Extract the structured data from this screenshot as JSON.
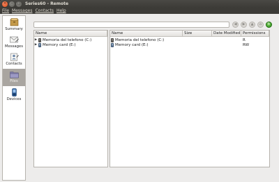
{
  "window": {
    "title": "Series60 - Remote"
  },
  "menubar": {
    "items": [
      {
        "label": "File"
      },
      {
        "label": "Messages"
      },
      {
        "label": "Contacts"
      },
      {
        "label": "Help"
      }
    ]
  },
  "sidebar": {
    "items": [
      {
        "label": "Summary",
        "icon": "summary-icon"
      },
      {
        "label": "Messages",
        "icon": "messages-icon"
      },
      {
        "label": "Contacts",
        "icon": "contacts-icon"
      },
      {
        "label": "Files",
        "icon": "folder-icon",
        "selected": true
      },
      {
        "label": "Devices",
        "icon": "phone-icon"
      }
    ]
  },
  "toolbar": {
    "path_value": "",
    "buttons": [
      "back-icon",
      "forward-icon",
      "up-icon",
      "home-icon",
      "refresh-icon"
    ]
  },
  "tree": {
    "header": "Name",
    "items": [
      {
        "label": "Memoria del telefono (C:)",
        "icon": "phone-icon"
      },
      {
        "label": "Memory card (E:)",
        "icon": "memory-card-icon"
      }
    ]
  },
  "list": {
    "columns": [
      "Name",
      "Size",
      "Date Modified",
      "Permissions"
    ],
    "rows": [
      {
        "name": "Memoria del telefono (C:)",
        "size": "",
        "date": "",
        "permissions": "R",
        "icon": "phone-icon"
      },
      {
        "name": "Memory card (E:)",
        "size": "",
        "date": "",
        "permissions": "RW",
        "icon": "memory-card-icon"
      }
    ]
  }
}
